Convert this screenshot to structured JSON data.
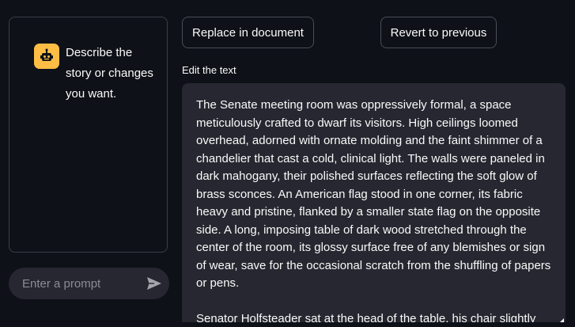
{
  "chat": {
    "assistant_message": "Describe the story or changes you want.",
    "prompt_placeholder": "Enter a prompt"
  },
  "toolbar": {
    "replace_label": "Replace in document",
    "revert_label": "Revert to previous"
  },
  "editor": {
    "label": "Edit the text",
    "paragraphs": [
      "The Senate meeting room was oppressively formal, a space meticulously crafted to dwarf its visitors. High ceilings loomed overhead, adorned with ornate molding and the faint shimmer of a chandelier that cast a cold, clinical light. The walls were paneled in dark mahogany, their polished surfaces reflecting the soft glow of brass sconces. An American flag stood in one corner, its fabric heavy and pristine, flanked by a smaller state flag on the opposite side. A long, imposing table of dark wood stretched through the center of the room, its glossy surface free of any blemishes or sign of wear, save for the occasional scratch from the shuffling of papers or pens.",
      "Senator Holfsteader sat at the head of the table, his chair slightly"
    ]
  },
  "colors": {
    "background": "#0e1117",
    "panel": "#262730",
    "avatar": "#ffbd45",
    "text": "#fafafa"
  },
  "icons": {
    "avatar": "robot-icon",
    "send": "send-arrow-icon",
    "resize": "resize-handle-icon"
  }
}
